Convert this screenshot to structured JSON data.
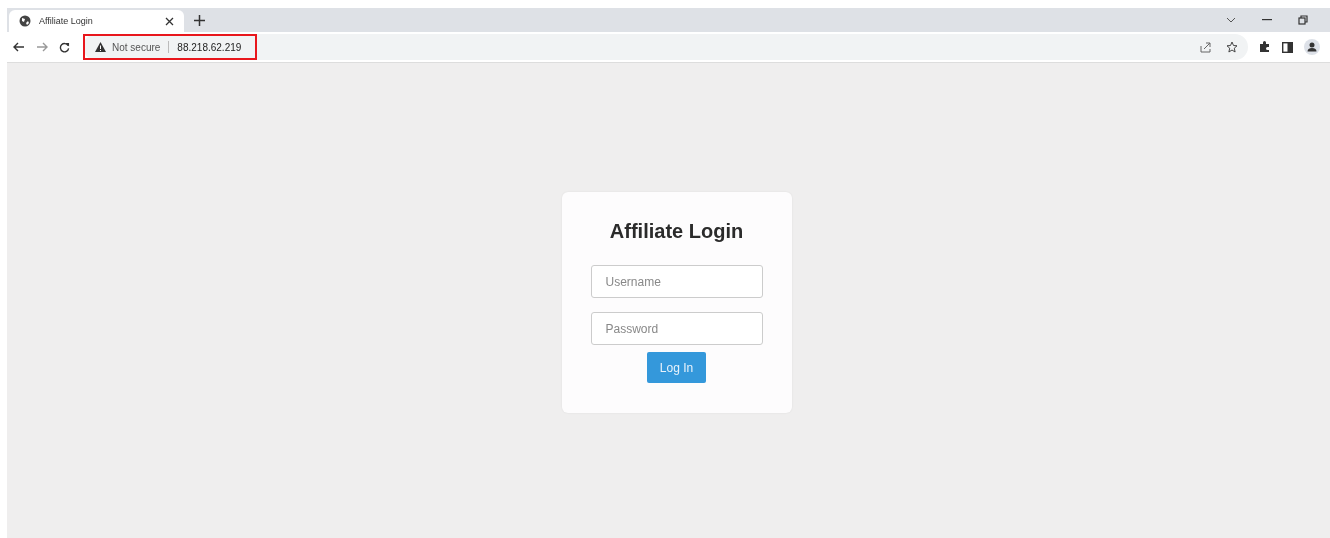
{
  "browser": {
    "tabs": [
      {
        "title": "Affiliate Login",
        "selected": true
      }
    ],
    "security": "Not secure",
    "address": "88.218.62.219",
    "address_highlighted": true
  },
  "login": {
    "title": "Affiliate Login",
    "username": {
      "placeholder": "Username"
    },
    "password": {
      "placeholder": "Password"
    },
    "button": "Log In"
  }
}
